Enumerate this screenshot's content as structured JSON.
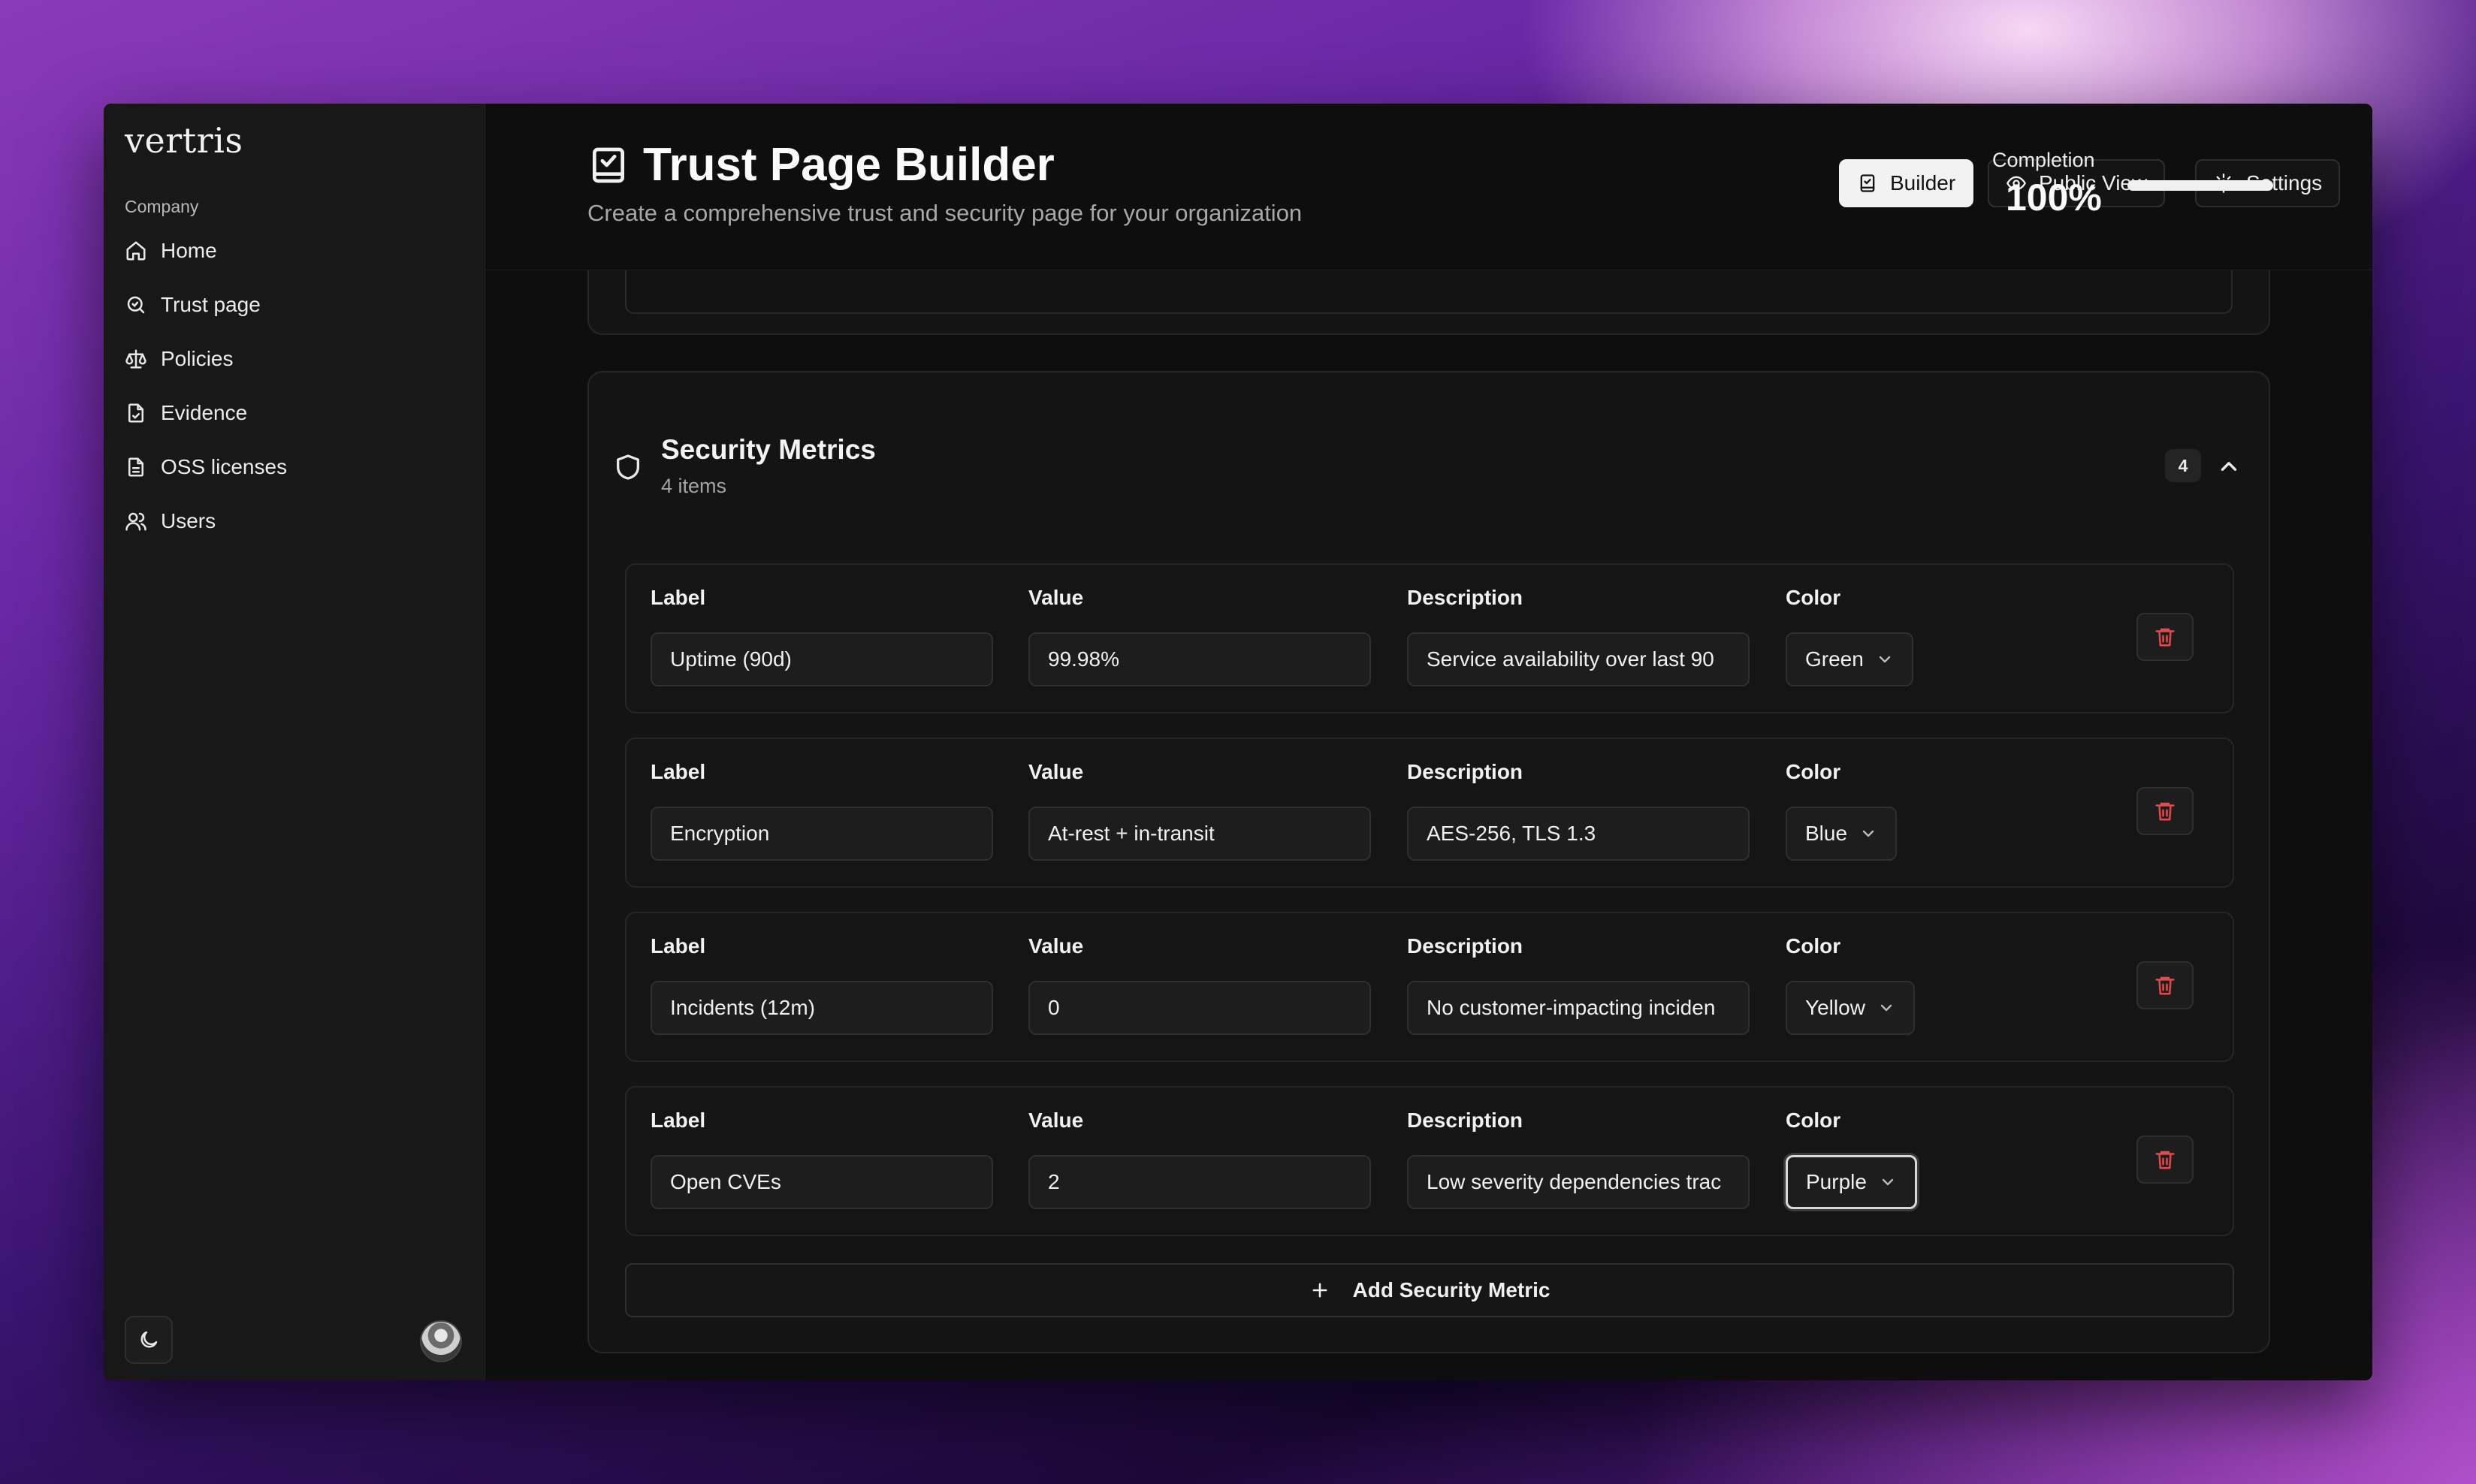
{
  "app": {
    "logo": "vertris",
    "section_label": "Company"
  },
  "sidebar": {
    "items": [
      {
        "label": "Home",
        "icon": "home-icon"
      },
      {
        "label": "Trust page",
        "icon": "search-icon"
      },
      {
        "label": "Policies",
        "icon": "scale-icon"
      },
      {
        "label": "Evidence",
        "icon": "file-check-icon"
      },
      {
        "label": "OSS licenses",
        "icon": "file-text-icon"
      },
      {
        "label": "Users",
        "icon": "users-icon"
      }
    ]
  },
  "header": {
    "title": "Trust Page Builder",
    "subtitle": "Create a comprehensive trust and security page for your organization",
    "builder_label": "Builder",
    "public_view_label": "Public View",
    "settings_label": "Settings",
    "completion_label": "Completion",
    "completion_value": "100%",
    "completion_fraction": 1.0
  },
  "section": {
    "title": "Security Metrics",
    "subtitle": "4 items",
    "count": "4",
    "label_header": "Label",
    "value_header": "Value",
    "description_header": "Description",
    "color_header": "Color",
    "add_label": "Add Security Metric"
  },
  "metrics": [
    {
      "label": "Uptime (90d)",
      "value": "99.98%",
      "description": "Service availability over last 90",
      "color": "Green"
    },
    {
      "label": "Encryption",
      "value": "At-rest + in-transit",
      "description": "AES-256, TLS 1.3",
      "color": "Blue"
    },
    {
      "label": "Incidents (12m)",
      "value": "0",
      "description": "No customer-impacting inciden",
      "color": "Yellow"
    },
    {
      "label": "Open CVEs",
      "value": "2",
      "description": "Low severity dependencies trac",
      "color": "Purple"
    }
  ],
  "colors": {
    "delete_icon": "#e5484d",
    "accent_light": "#f2f2f2"
  }
}
